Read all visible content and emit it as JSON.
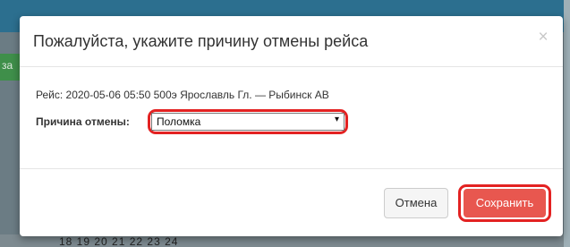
{
  "background": {
    "sidebar_fragment": "за",
    "calendar_fragment": "18  19  20  21  22  23  24"
  },
  "modal": {
    "title": "Пожалуйста, укажите причину отмены рейса",
    "close_glyph": "×",
    "trip_line": "Рейс: 2020-05-06 05:50 500э Ярославль Гл. — Рыбинск АВ",
    "reason_label": "Причина отмены:",
    "reason_select": {
      "selected": "Поломка",
      "arrow_glyph": "▾"
    },
    "buttons": {
      "cancel_label": "Отмена",
      "save_label": "Сохранить"
    }
  },
  "colors": {
    "save_button": "#e8574f",
    "highlight_outline": "#e32222",
    "backdrop": "#6b7c84"
  }
}
